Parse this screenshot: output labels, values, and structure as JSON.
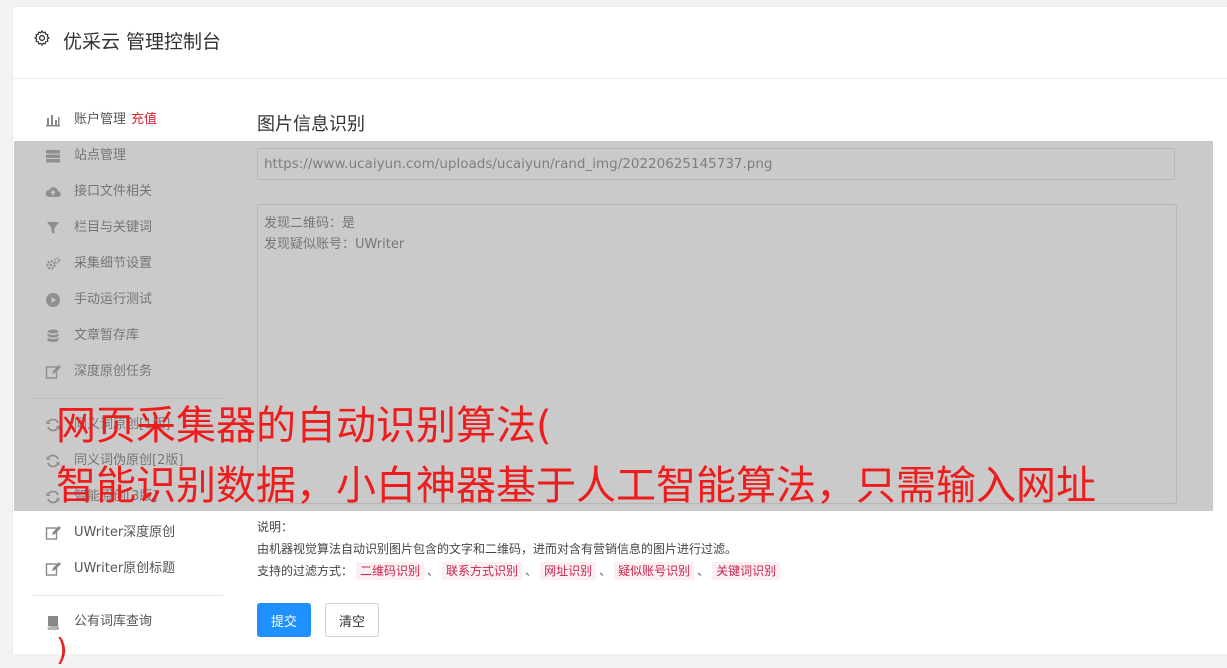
{
  "header": {
    "title": "优采云 管理控制台"
  },
  "sidebar": {
    "items": [
      {
        "label": "账户管理",
        "extra": "充值",
        "icon": "bar-chart-icon"
      },
      {
        "label": "站点管理",
        "icon": "server-icon"
      },
      {
        "label": "接口文件相关",
        "icon": "cloud-upload-icon"
      },
      {
        "label": "栏目与关键词",
        "icon": "filter-icon"
      },
      {
        "label": "采集细节设置",
        "icon": "gears-icon"
      },
      {
        "label": "手动运行测试",
        "icon": "play-circle-icon"
      },
      {
        "label": "文章暂存库",
        "icon": "database-icon"
      },
      {
        "label": "深度原创任务",
        "icon": "edit-icon"
      },
      {
        "label": "同义词原创[1版]",
        "icon": "refresh-icon"
      },
      {
        "label": "同义词伪原创[2版]",
        "icon": "refresh-icon"
      },
      {
        "label": "智能原创[3版]",
        "icon": "refresh-icon"
      },
      {
        "label": "UWriter深度原创",
        "icon": "edit-icon"
      },
      {
        "label": "UWriter原创标题",
        "icon": "edit-icon"
      },
      {
        "label": "公有词库查询",
        "icon": "book-icon"
      }
    ]
  },
  "main": {
    "section_title": "图片信息识别",
    "url_value": "https://www.ucaiyun.com/uploads/ucaiyun/rand_img/20220625145737.png",
    "result_lines": [
      "发现二维码：是",
      "发现疑似账号：UWriter"
    ],
    "notes_title": "说明：",
    "notes_desc": "由机器视觉算法自动识别图片包含的文字和二维码，进而对含有营销信息的图片进行过滤。",
    "filter_prefix": "支持的过滤方式：",
    "filter_sep": "、",
    "filter_tags": [
      "二维码识别",
      "联系方式识别",
      "网址识别",
      "疑似账号识别",
      "关键词识别"
    ],
    "submit_label": "提交",
    "clear_label": "清空"
  },
  "overlay": {
    "line1": "网页采集器的自动识别算法(",
    "line2": "智能识别数据，小白神器基于人工智能算法，只需输入网址",
    "line3": ")"
  }
}
